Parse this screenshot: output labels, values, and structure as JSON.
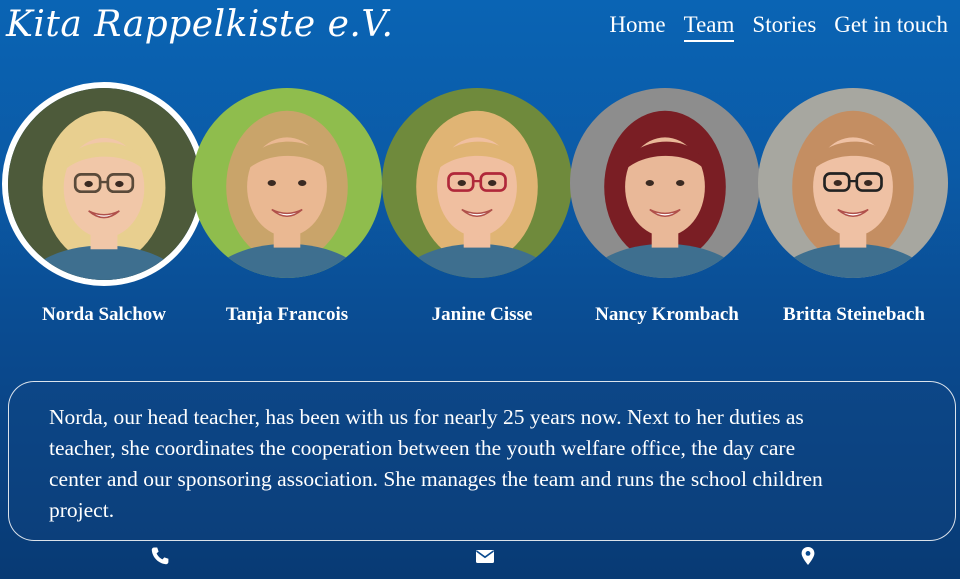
{
  "site": {
    "logo": "Kita Rappelkiste e.V."
  },
  "nav": {
    "items": [
      {
        "label": "Home",
        "active": false
      },
      {
        "label": "Team",
        "active": true
      },
      {
        "label": "Stories",
        "active": false
      },
      {
        "label": "Get in touch",
        "active": false
      }
    ]
  },
  "team": {
    "members": [
      {
        "name": "Norda Salchow",
        "selected": true,
        "hair": "#e8cf8f",
        "bg": "#4d5a3a",
        "skin": "#f1c7a8",
        "glasses": "#5a4a3a"
      },
      {
        "name": "Tanja Francois",
        "selected": false,
        "hair": "#c9a46a",
        "bg": "#8fbd4d",
        "skin": "#eab892",
        "glasses": ""
      },
      {
        "name": "Janine Cisse",
        "selected": false,
        "hair": "#e0b474",
        "bg": "#6f8a3c",
        "skin": "#f0bfa0",
        "glasses": "#b0283a"
      },
      {
        "name": "Nancy Krombach",
        "selected": false,
        "hair": "#7a1e24",
        "bg": "#8d8d8d",
        "skin": "#e9b898",
        "glasses": ""
      },
      {
        "name": "Britta Steinebach",
        "selected": false,
        "hair": "#c48e62",
        "bg": "#a7a7a0",
        "skin": "#efc1a4",
        "glasses": "#222222"
      }
    ]
  },
  "bio": {
    "text": "Norda, our head teacher, has been with us for nearly 25 years now. Next to her duties as teacher, she coordinates the cooperation between the youth welfare office, the day care center and our sponsoring association. She manages the team and runs the school children project."
  },
  "footer": {
    "icons": [
      "phone-icon",
      "envelope-icon",
      "map-marker-icon"
    ]
  }
}
